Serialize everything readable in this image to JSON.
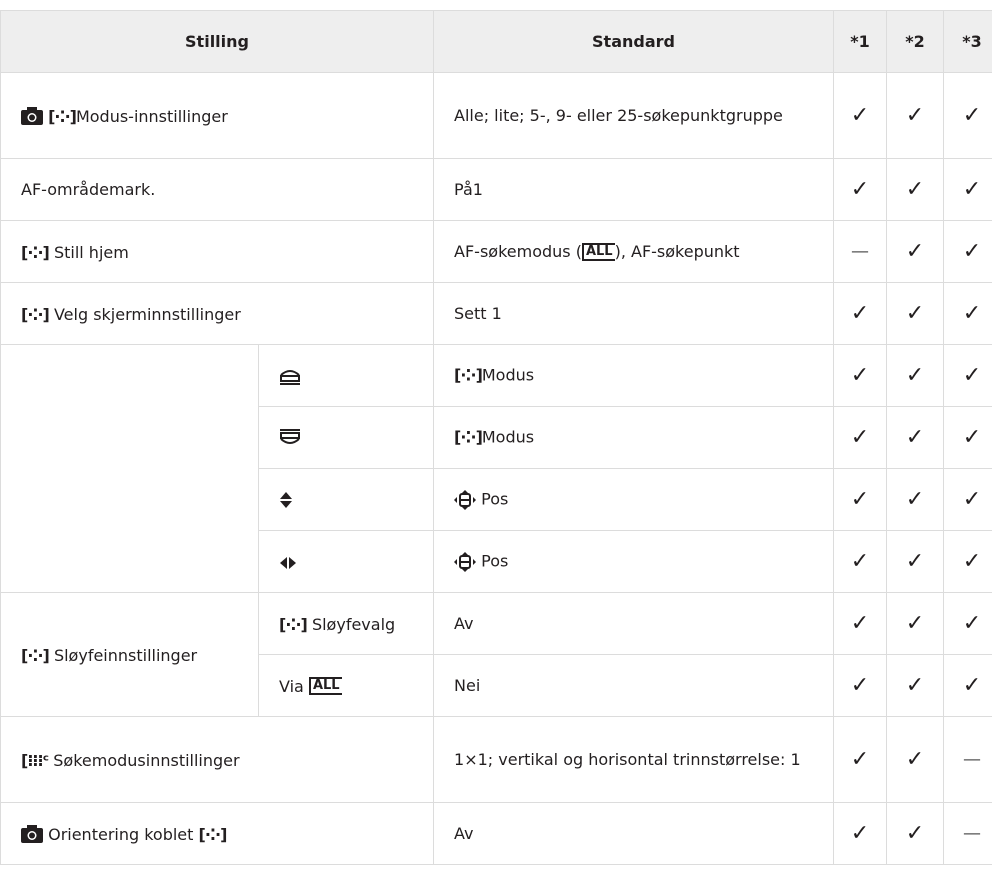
{
  "header": {
    "col1": "Stilling",
    "col2": "Standard",
    "col3": "*1",
    "col4": "*2",
    "col5": "*3"
  },
  "rows": [
    {
      "label": "Modus-innstillinger",
      "icons": [
        "camera-icon",
        "af-target-icon"
      ],
      "standard": "Alle; lite; 5-, 9- eller 25-søkepunktgruppe",
      "c1": "✓",
      "c2": "✓",
      "c3": "✓"
    },
    {
      "label": "AF-områdemark.",
      "standard": "På1",
      "c1": "✓",
      "c2": "✓",
      "c3": "✓"
    },
    {
      "label": "Still hjem",
      "icons": [
        "af-target-icon"
      ],
      "standard_prefix": "AF-søkemodus (",
      "standard_suffix": "), AF-søkepunkt",
      "standard_icon_text": "ALL",
      "c1": "—",
      "c2": "✓",
      "c3": "✓"
    },
    {
      "label": "Velg skjerminnstillinger",
      "icons": [
        "af-target-icon"
      ],
      "standard": "Sett 1",
      "c1": "✓",
      "c2": "✓",
      "c3": "✓"
    },
    {
      "sub_icon": "front-dial-icon",
      "standard": "Modus",
      "c1": "✓",
      "c2": "✓",
      "c3": "✓"
    },
    {
      "sub_icon": "rear-dial-icon",
      "standard": "Modus",
      "c1": "✓",
      "c2": "✓",
      "c3": "✓"
    },
    {
      "sub_icon": "up-down-arrows-icon",
      "standard": "Pos",
      "c1": "✓",
      "c2": "✓",
      "c3": "✓"
    },
    {
      "sub_icon": "left-right-arrows-icon",
      "standard": "Pos",
      "c1": "✓",
      "c2": "✓",
      "c3": "✓"
    },
    {
      "label": "Sløyfeinnstillinger",
      "sub_label": "Sløyfevalg",
      "standard": "Av",
      "c1": "✓",
      "c2": "✓",
      "c3": "✓"
    },
    {
      "sub_label": "Via",
      "sub_icon_text": "ALL",
      "standard": "Nei",
      "c1": "✓",
      "c2": "✓",
      "c3": "✓"
    },
    {
      "label": "Søkemodusinnstillinger",
      "standard": "1×1; vertikal og horisontal trinnstørrelse: 1",
      "c1": "✓",
      "c2": "✓",
      "c3": "—"
    },
    {
      "label": "Orientering koblet",
      "standard": "Av",
      "c1": "✓",
      "c2": "✓",
      "c3": "—"
    }
  ]
}
